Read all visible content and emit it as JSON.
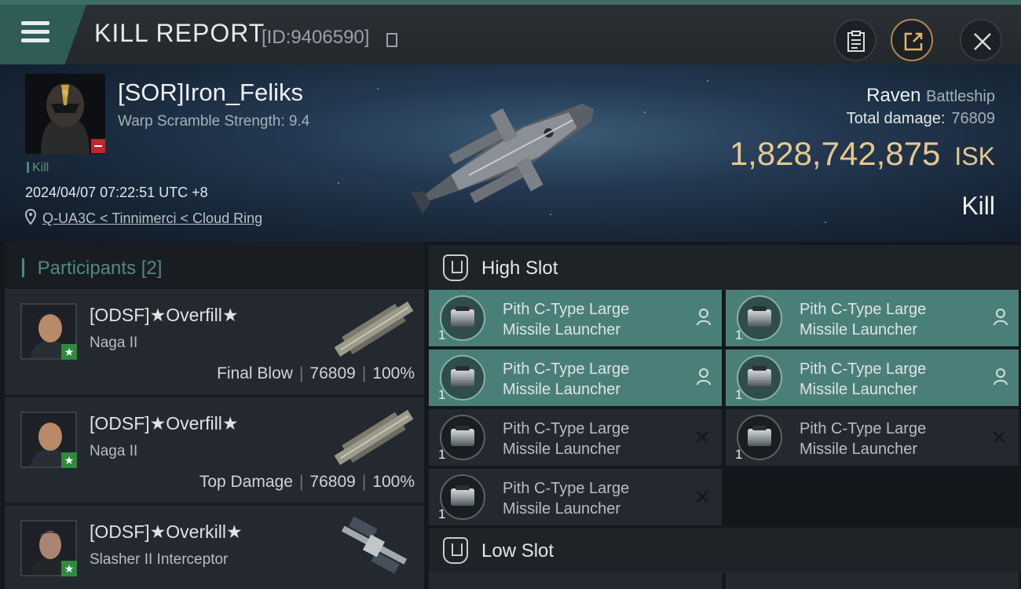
{
  "header": {
    "title": "KILL REPORT",
    "report_id": "[ID:9406590]",
    "icons": [
      "menu-icon",
      "clipboard-icon",
      "share-icon",
      "close-icon",
      "copy-icon"
    ]
  },
  "victim": {
    "name": "[SOR]Iron_Feliks",
    "warp_scramble": "Warp Scramble Strength: 9.4",
    "tag": "Kill",
    "datetime": "2024/04/07 07:22:51 UTC +8",
    "location": "Q-UA3C < Tinnimerci < Cloud Ring",
    "ship_name": "Raven",
    "ship_class": "Battleship",
    "damage_label": "Total damage:",
    "damage_value": "76809",
    "isk_value": "1,828,742,875",
    "isk_unit": "ISK",
    "result": "Kill"
  },
  "participants": {
    "title": "Participants",
    "count": "[2]",
    "rows": [
      {
        "name": "[ODSF]★Overfill★",
        "ship": "Naga II",
        "role": "Final Blow",
        "damage": "76809",
        "percent": "100%"
      },
      {
        "name": "[ODSF]★Overfill★",
        "ship": "Naga II",
        "role": "Top Damage",
        "damage": "76809",
        "percent": "100%"
      },
      {
        "name": "[ODSF]★Overkill★",
        "ship": "Slasher II Interceptor",
        "role": "",
        "damage": "",
        "percent": ""
      }
    ]
  },
  "high_slot": {
    "title": "High Slot",
    "modules": [
      {
        "line1": "Pith C-Type Large",
        "line2": "Missile Launcher",
        "qty": "1",
        "state": "dropped"
      },
      {
        "line1": "Pith C-Type Large",
        "line2": "Missile Launcher",
        "qty": "1",
        "state": "dropped"
      },
      {
        "line1": "Pith C-Type Large",
        "line2": "Missile Launcher",
        "qty": "1",
        "state": "dropped"
      },
      {
        "line1": "Pith C-Type Large",
        "line2": "Missile Launcher",
        "qty": "1",
        "state": "dropped"
      },
      {
        "line1": "Pith C-Type Large",
        "line2": "Missile Launcher",
        "qty": "1",
        "state": "destroyed"
      },
      {
        "line1": "Pith C-Type Large",
        "line2": "Missile Launcher",
        "qty": "1",
        "state": "destroyed"
      },
      {
        "line1": "Pith C-Type Large",
        "line2": "Missile Launcher",
        "qty": "1",
        "state": "destroyed"
      }
    ]
  },
  "low_slot": {
    "title": "Low Slot"
  },
  "colors": {
    "accent": "#4a7f79",
    "isk": "#e8c88e",
    "badge_red": "#c0262a",
    "badge_green": "#2e8b3e"
  }
}
